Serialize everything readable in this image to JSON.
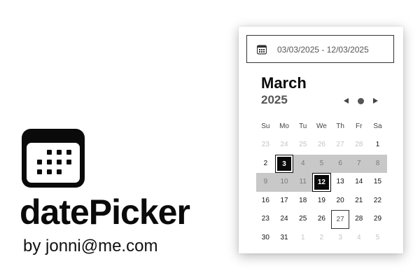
{
  "brand": {
    "title": "datePicker",
    "subtitle": "by jonni@me.com",
    "logo_icon": "calendar-icon"
  },
  "input": {
    "icon": "calendar-icon",
    "value": "03/03/2025 - 12/03/2025"
  },
  "header": {
    "month": "March",
    "year": "2025",
    "nav": {
      "prev_icon": "triangle-left-icon",
      "today_icon": "dot-icon",
      "next_icon": "triangle-right-icon"
    }
  },
  "weekdays": [
    "Su",
    "Mo",
    "Tu",
    "We",
    "Th",
    "Fr",
    "Sa"
  ],
  "weeks": [
    [
      {
        "d": "23",
        "s": "other"
      },
      {
        "d": "24",
        "s": "other"
      },
      {
        "d": "25",
        "s": "other"
      },
      {
        "d": "26",
        "s": "other"
      },
      {
        "d": "27",
        "s": "other"
      },
      {
        "d": "28",
        "s": "other"
      },
      {
        "d": "1",
        "s": ""
      }
    ],
    [
      {
        "d": "2",
        "s": ""
      },
      {
        "d": "3",
        "s": "endpoint"
      },
      {
        "d": "4",
        "s": "in-range"
      },
      {
        "d": "5",
        "s": "in-range"
      },
      {
        "d": "6",
        "s": "in-range"
      },
      {
        "d": "7",
        "s": "in-range"
      },
      {
        "d": "8",
        "s": "in-range"
      }
    ],
    [
      {
        "d": "9",
        "s": "in-range"
      },
      {
        "d": "10",
        "s": "in-range"
      },
      {
        "d": "11",
        "s": "in-range"
      },
      {
        "d": "12",
        "s": "endpoint"
      },
      {
        "d": "13",
        "s": ""
      },
      {
        "d": "14",
        "s": ""
      },
      {
        "d": "15",
        "s": ""
      }
    ],
    [
      {
        "d": "16",
        "s": ""
      },
      {
        "d": "17",
        "s": ""
      },
      {
        "d": "18",
        "s": ""
      },
      {
        "d": "19",
        "s": ""
      },
      {
        "d": "20",
        "s": ""
      },
      {
        "d": "21",
        "s": ""
      },
      {
        "d": "22",
        "s": ""
      }
    ],
    [
      {
        "d": "23",
        "s": ""
      },
      {
        "d": "24",
        "s": ""
      },
      {
        "d": "25",
        "s": ""
      },
      {
        "d": "26",
        "s": ""
      },
      {
        "d": "27",
        "s": "today"
      },
      {
        "d": "28",
        "s": ""
      },
      {
        "d": "29",
        "s": ""
      }
    ],
    [
      {
        "d": "30",
        "s": ""
      },
      {
        "d": "31",
        "s": ""
      },
      {
        "d": "1",
        "s": "other"
      },
      {
        "d": "2",
        "s": "other"
      },
      {
        "d": "3",
        "s": "other"
      },
      {
        "d": "4",
        "s": "other"
      },
      {
        "d": "5",
        "s": "other"
      }
    ]
  ],
  "colors": {
    "endpoint_bg": "#0a0a0a",
    "range_bg": "#c8c8c8",
    "other_month_text": "#c4c4c4"
  }
}
